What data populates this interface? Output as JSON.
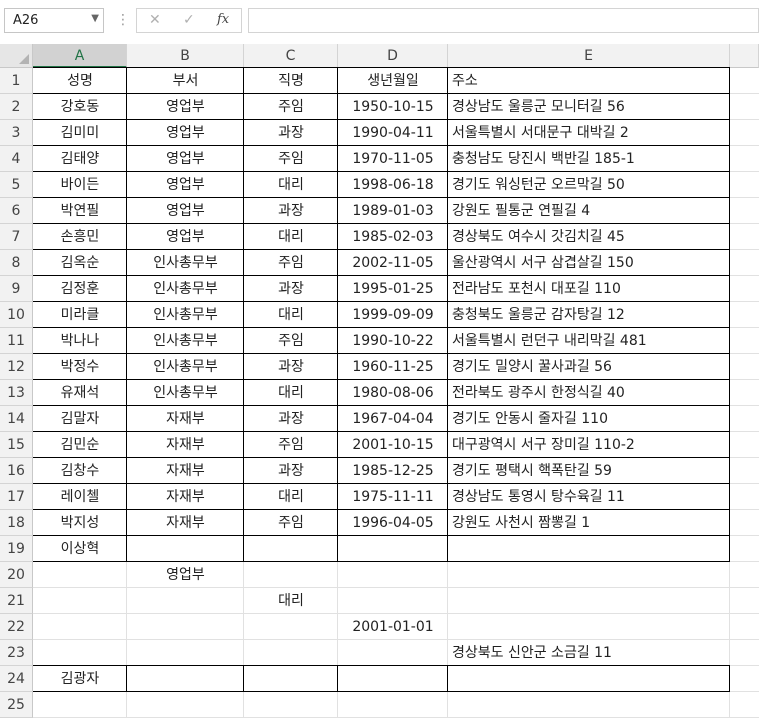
{
  "formula_bar": {
    "name_box": "A26",
    "formula": ""
  },
  "columns": [
    "A",
    "B",
    "C",
    "D",
    "E"
  ],
  "selected_column": "A",
  "rows": [
    {
      "n": "1",
      "cells": [
        "성명",
        "부서",
        "직명",
        "생년월일",
        "주소"
      ]
    },
    {
      "n": "2",
      "cells": [
        "강호동",
        "영업부",
        "주임",
        "1950-10-15",
        "경상남도 울릉군 모니터길 56"
      ]
    },
    {
      "n": "3",
      "cells": [
        "김미미",
        "영업부",
        "과장",
        "1990-04-11",
        "서울특별시 서대문구 대박길 2"
      ]
    },
    {
      "n": "4",
      "cells": [
        "김태양",
        "영업부",
        "주임",
        "1970-11-05",
        "충청남도 당진시 백반길 185-1"
      ]
    },
    {
      "n": "5",
      "cells": [
        "바이든",
        "영업부",
        "대리",
        "1998-06-18",
        "경기도 워싱턴군 오르막길 50"
      ]
    },
    {
      "n": "6",
      "cells": [
        "박연필",
        "영업부",
        "과장",
        "1989-01-03",
        "강원도 필통군 연필길 4"
      ]
    },
    {
      "n": "7",
      "cells": [
        "손흥민",
        "영업부",
        "대리",
        "1985-02-03",
        "경상북도 여수시 갓김치길 45"
      ]
    },
    {
      "n": "8",
      "cells": [
        "김옥순",
        "인사총무부",
        "주임",
        "2002-11-05",
        "울산광역시 서구 삼겹살길 150"
      ]
    },
    {
      "n": "9",
      "cells": [
        "김정훈",
        "인사총무부",
        "과장",
        "1995-01-25",
        "전라남도 포천시 대포길 110"
      ]
    },
    {
      "n": "10",
      "cells": [
        "미라클",
        "인사총무부",
        "대리",
        "1999-09-09",
        "충청북도 울릉군 감자탕길 12"
      ]
    },
    {
      "n": "11",
      "cells": [
        "박나나",
        "인사총무부",
        "주임",
        "1990-10-22",
        "서울특별시 런던구 내리막길 481"
      ]
    },
    {
      "n": "12",
      "cells": [
        "박정수",
        "인사총무부",
        "과장",
        "1960-11-25",
        "경기도 밀양시 꿀사과길 56"
      ]
    },
    {
      "n": "13",
      "cells": [
        "유재석",
        "인사총무부",
        "대리",
        "1980-08-06",
        "전라북도 광주시 한정식길 40"
      ]
    },
    {
      "n": "14",
      "cells": [
        "김말자",
        "자재부",
        "과장",
        "1967-04-04",
        "경기도 안동시 줄자길 110"
      ]
    },
    {
      "n": "15",
      "cells": [
        "김민순",
        "자재부",
        "주임",
        "2001-10-15",
        "대구광역시 서구 장미길 110-2"
      ]
    },
    {
      "n": "16",
      "cells": [
        "김창수",
        "자재부",
        "과장",
        "1985-12-25",
        "경기도 평택시 핵폭탄길 59"
      ]
    },
    {
      "n": "17",
      "cells": [
        "레이첼",
        "자재부",
        "대리",
        "1975-11-11",
        "경상남도 통영시 탕수육길 11"
      ]
    },
    {
      "n": "18",
      "cells": [
        "박지성",
        "자재부",
        "주임",
        "1996-04-05",
        "강원도 사천시 짬뽕길 1"
      ]
    },
    {
      "n": "19",
      "cells": [
        "이상혁",
        "",
        "",
        "",
        ""
      ]
    },
    {
      "n": "20",
      "cells": [
        "",
        "영업부",
        "",
        "",
        ""
      ]
    },
    {
      "n": "21",
      "cells": [
        "",
        "",
        "대리",
        "",
        ""
      ]
    },
    {
      "n": "22",
      "cells": [
        "",
        "",
        "",
        "2001-01-01",
        ""
      ]
    },
    {
      "n": "23",
      "cells": [
        "",
        "",
        "",
        "",
        "경상북도 신안군 소금길 11"
      ]
    },
    {
      "n": "24",
      "cells": [
        "김광자",
        "",
        "",
        "",
        ""
      ]
    },
    {
      "n": "25",
      "cells": [
        "",
        "",
        "",
        "",
        ""
      ]
    }
  ],
  "bordered_rows": [
    "1",
    "2",
    "3",
    "4",
    "5",
    "6",
    "7",
    "8",
    "9",
    "10",
    "11",
    "12",
    "13",
    "14",
    "15",
    "16",
    "17",
    "18",
    "19",
    "24"
  ],
  "icons": {
    "name_box_dropdown": "chevron-down-icon",
    "cancel": "close-icon",
    "enter": "check-icon",
    "function": "fx-icon"
  }
}
